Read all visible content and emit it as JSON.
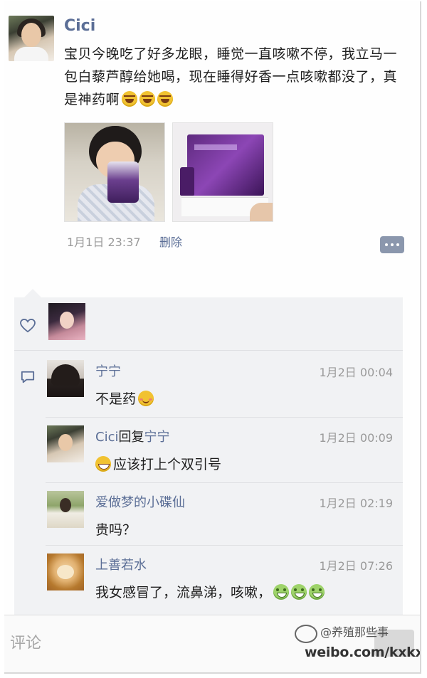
{
  "post": {
    "author": "Cici",
    "text": "宝贝今晚吃了好多龙眼，睡觉一直咳嗽不停，我立马一包白藜芦醇给她喝，现在睡得好香一点咳嗽都没了，真是神药啊",
    "text_emojis": [
      "laugh",
      "laugh",
      "laugh"
    ],
    "photos": [
      "child-drinking-photo",
      "purple-product-box-photo"
    ],
    "time": "1月1日 23:37",
    "delete_label": "删除"
  },
  "likes": {
    "avatars": [
      "liker-avatar"
    ]
  },
  "comments": [
    {
      "name": "宁宁",
      "reply_to": "",
      "time": "1月2日 00:04",
      "text": "不是药",
      "emoji_before": "",
      "emoji_after": "shy"
    },
    {
      "name": "Cici",
      "reply_label": "回复",
      "reply_to": "宁宁",
      "time": "1月2日 00:09",
      "text": "应该打上个双引号",
      "emoji_before": "grin",
      "emoji_after": ""
    },
    {
      "name": "爱做梦的小碟仙",
      "reply_to": "",
      "time": "1月2日 02:19",
      "text": "贵吗？",
      "emoji_before": "",
      "emoji_after": ""
    },
    {
      "name": "上善若水",
      "reply_to": "",
      "time": "1月2日 07:26",
      "text": "我女感冒了，流鼻涕，咳嗽，",
      "emoji_before": "",
      "emoji_after": "sick"
    }
  ],
  "input": {
    "placeholder": "评论"
  },
  "watermark": {
    "handle": "@养殖那些事",
    "url": "weibo.com/kxkxing"
  },
  "colors": {
    "name_blue": "#5b6e96",
    "panel_bg": "#f1f2f4",
    "time_gray": "#9a9a9a"
  }
}
